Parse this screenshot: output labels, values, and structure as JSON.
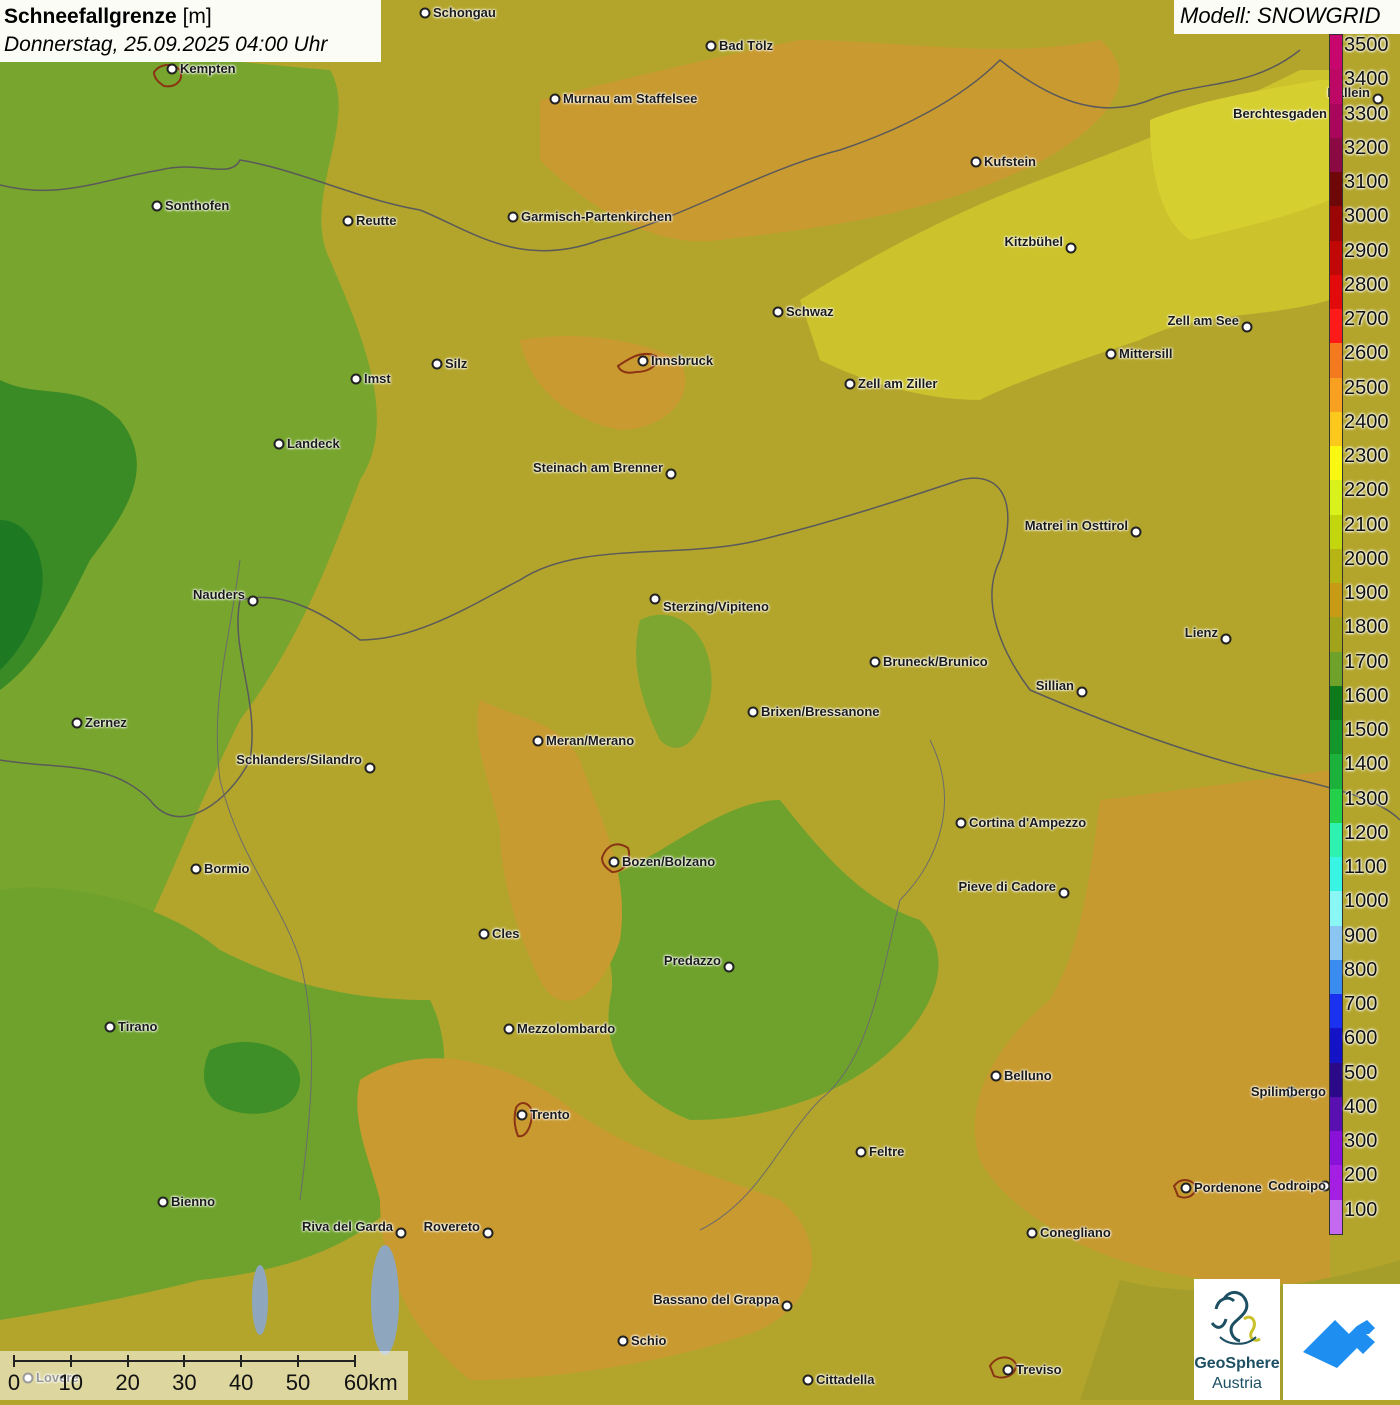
{
  "header": {
    "title_bold": "Schneefallgrenze",
    "title_unit": "[m]",
    "datetime": "Donnerstag, 25.09.2025 04:00 Uhr"
  },
  "model": {
    "label": "Modell: SNOWGRID"
  },
  "legend": {
    "unit": "m",
    "steps": [
      {
        "value": "3500",
        "color": "#c8076e"
      },
      {
        "value": "3400",
        "color": "#be0866"
      },
      {
        "value": "3300",
        "color": "#a9075c"
      },
      {
        "value": "3200",
        "color": "#8c0a44"
      },
      {
        "value": "3100",
        "color": "#6e0707"
      },
      {
        "value": "3000",
        "color": "#9a0505"
      },
      {
        "value": "2900",
        "color": "#c20707"
      },
      {
        "value": "2800",
        "color": "#e20a0a"
      },
      {
        "value": "2700",
        "color": "#ff1a1a"
      },
      {
        "value": "2600",
        "color": "#f47a20"
      },
      {
        "value": "2500",
        "color": "#f8a01f"
      },
      {
        "value": "2400",
        "color": "#fbc91c"
      },
      {
        "value": "2300",
        "color": "#fdf714"
      },
      {
        "value": "2200",
        "color": "#d9f21b"
      },
      {
        "value": "2100",
        "color": "#c3d50c"
      },
      {
        "value": "2000",
        "color": "#b6b514"
      },
      {
        "value": "1900",
        "color": "#c89b14"
      },
      {
        "value": "1800",
        "color": "#a1a41b"
      },
      {
        "value": "1700",
        "color": "#6fa22a"
      },
      {
        "value": "1600",
        "color": "#0f7a1c"
      },
      {
        "value": "1500",
        "color": "#14962a"
      },
      {
        "value": "1400",
        "color": "#1cb13a"
      },
      {
        "value": "1300",
        "color": "#24d04a"
      },
      {
        "value": "1200",
        "color": "#2ef3b0"
      },
      {
        "value": "1100",
        "color": "#38f5e3"
      },
      {
        "value": "1000",
        "color": "#8af7f5"
      },
      {
        "value": "900",
        "color": "#8bc6f3"
      },
      {
        "value": "800",
        "color": "#3a8cf0"
      },
      {
        "value": "700",
        "color": "#1a32f0"
      },
      {
        "value": "600",
        "color": "#1414c6"
      },
      {
        "value": "500",
        "color": "#2a0a88"
      },
      {
        "value": "400",
        "color": "#5a0fb0"
      },
      {
        "value": "300",
        "color": "#8a12d8"
      },
      {
        "value": "200",
        "color": "#a51fe2"
      },
      {
        "value": "100",
        "color": "#c46af0"
      }
    ]
  },
  "scale_bar": {
    "labels": [
      "0",
      "10",
      "20",
      "30",
      "40",
      "50",
      "60km"
    ]
  },
  "logos": {
    "geosphere_line1": "GeoSphere",
    "geosphere_line2": "Austria"
  },
  "cities": [
    {
      "name": "Schongau"
    },
    {
      "name": "Bad Tölz"
    },
    {
      "name": "Kempten"
    },
    {
      "name": "Murnau am Staffelsee"
    },
    {
      "name": "Berchtesgaden"
    },
    {
      "name": "Hallein"
    },
    {
      "name": "Kufstein"
    },
    {
      "name": "Sonthofen"
    },
    {
      "name": "Reutte"
    },
    {
      "name": "Garmisch-Partenkirchen"
    },
    {
      "name": "Kitzbühel"
    },
    {
      "name": "Schwaz"
    },
    {
      "name": "Zell am See"
    },
    {
      "name": "Innsbruck"
    },
    {
      "name": "Silz"
    },
    {
      "name": "Imst"
    },
    {
      "name": "Mittersill"
    },
    {
      "name": "Zell am Ziller"
    },
    {
      "name": "Landeck"
    },
    {
      "name": "Steinach am Brenner"
    },
    {
      "name": "Matrei in Osttirol"
    },
    {
      "name": "Nauders"
    },
    {
      "name": "Sterzing/Vipiteno"
    },
    {
      "name": "Lienz"
    },
    {
      "name": "Bruneck/Brunico"
    },
    {
      "name": "Sillian"
    },
    {
      "name": "Brixen/Bressanone"
    },
    {
      "name": "Zernez"
    },
    {
      "name": "Meran/Merano"
    },
    {
      "name": "Schlanders/Silandro"
    },
    {
      "name": "Cortina d'Ampezzo"
    },
    {
      "name": "Bozen/Bolzano"
    },
    {
      "name": "Bormio"
    },
    {
      "name": "Pieve di Cadore"
    },
    {
      "name": "Cles"
    },
    {
      "name": "Predazzo"
    },
    {
      "name": "Tirano"
    },
    {
      "name": "Mezzolombardo"
    },
    {
      "name": "Belluno"
    },
    {
      "name": "Spilimbergo"
    },
    {
      "name": "Trento"
    },
    {
      "name": "Feltre"
    },
    {
      "name": "Pordenone"
    },
    {
      "name": "Codroipo"
    },
    {
      "name": "Bienno"
    },
    {
      "name": "Riva del Garda"
    },
    {
      "name": "Rovereto"
    },
    {
      "name": "Conegliano"
    },
    {
      "name": "Bassano del Grappa"
    },
    {
      "name": "Schio"
    },
    {
      "name": "Treviso"
    },
    {
      "name": "Cittadella"
    },
    {
      "name": "Lovere"
    }
  ]
}
